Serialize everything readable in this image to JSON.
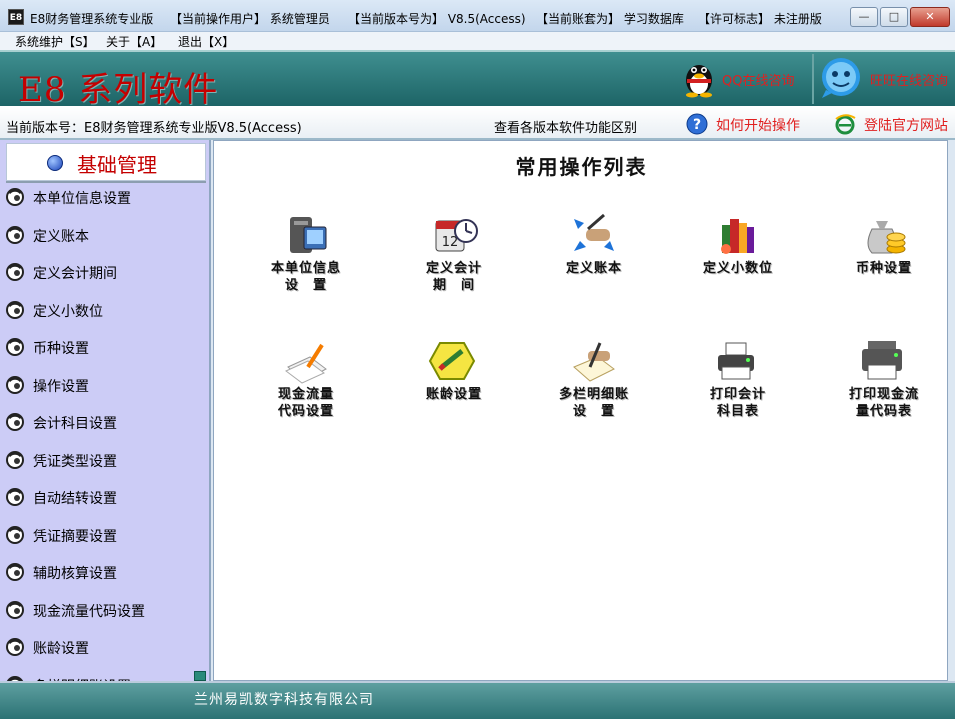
{
  "window": {
    "app_icon_text": "E8",
    "title_segments": [
      "E8财务管理系统专业版",
      "【当前操作用户】 系统管理员",
      "【当前版本号为】 V8.5(Access)",
      "【当前账套为】 学习数据库",
      "【许可标志】 未注册版"
    ],
    "buttons": {
      "minimize": "—",
      "maximize": "□",
      "close": "✕"
    }
  },
  "menu": {
    "items": [
      "系统维护【S】",
      "关于【A】",
      "退出【X】"
    ]
  },
  "banner": {
    "brand": "E8 系列软件",
    "qq_label": "QQ在线咨询",
    "wang_label": "旺旺在线咨询"
  },
  "infobar": {
    "version": "当前版本号：E8财务管理系统专业版V8.5(Access)",
    "compare": "查看各版本软件功能区别",
    "how_to": "如何开始操作",
    "official_site": "登陆官方网站"
  },
  "sidebar": {
    "title": "基础管理",
    "items": [
      "本单位信息设置",
      "定义账本",
      "定义会计期间",
      "定义小数位",
      "币种设置",
      "操作设置",
      "会计科目设置",
      "凭证类型设置",
      "自动结转设置",
      "凭证摘要设置",
      "辅助核算设置",
      "现金流量代码设置",
      "账龄设置",
      "多栏明细账设置"
    ]
  },
  "main": {
    "title": "常用操作列表",
    "tiles": [
      {
        "l1": "本单位信息",
        "l2": "设　置",
        "icon": "trash-monitor-icon"
      },
      {
        "l1": "定义会计",
        "l2": "期　间",
        "icon": "calendar-clock-icon"
      },
      {
        "l1": "定义账本",
        "l2": "",
        "icon": "hand-writing-arrows-icon"
      },
      {
        "l1": "定义小数位",
        "l2": "",
        "icon": "books-icon"
      },
      {
        "l1": "币种设置",
        "l2": "",
        "icon": "money-bag-coins-icon"
      },
      {
        "l1": "现金流量",
        "l2": "代码设置",
        "icon": "document-pen-icon"
      },
      {
        "l1": "账龄设置",
        "l2": "",
        "icon": "pencil-hexagon-icon"
      },
      {
        "l1": "多栏明细账",
        "l2": "设　置",
        "icon": "hand-pen-paper-icon"
      },
      {
        "l1": "打印会计",
        "l2": "科目表",
        "icon": "printer-icon"
      },
      {
        "l1": "打印现金流",
        "l2": "量代码表",
        "icon": "printer-scanner-icon"
      }
    ]
  },
  "footer": {
    "company": "兰州易凯数字科技有限公司"
  }
}
